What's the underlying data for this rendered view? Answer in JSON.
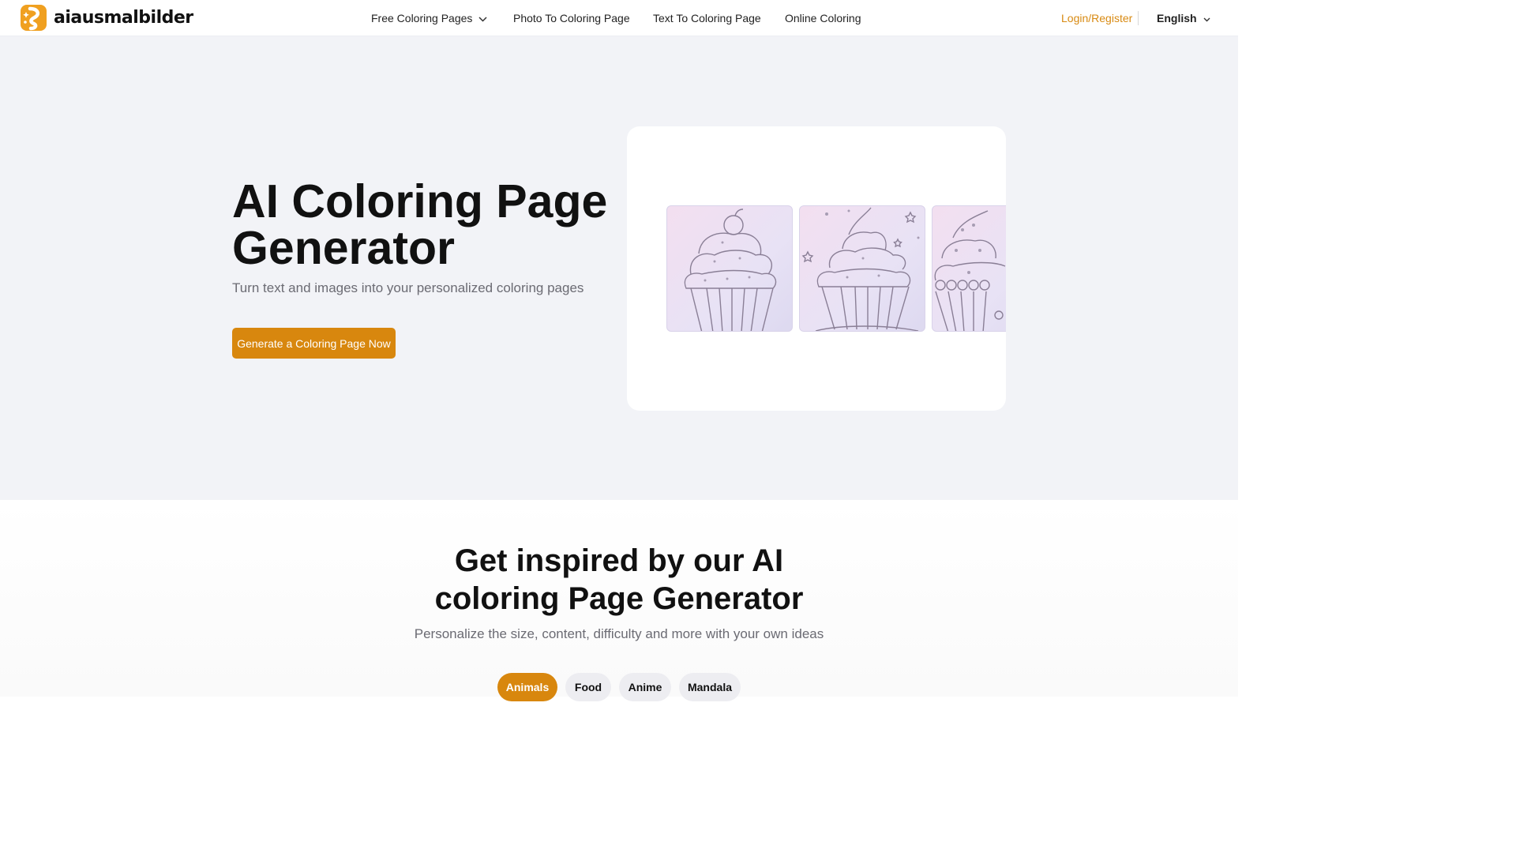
{
  "brand": {
    "name": "aiausmalbilder",
    "accent": "#f0a020"
  },
  "nav": {
    "items": [
      {
        "label": "Free Coloring Pages",
        "has_dropdown": true
      },
      {
        "label": "Photo To Coloring Page"
      },
      {
        "label": "Text To Coloring Page"
      },
      {
        "label": "Online Coloring"
      }
    ],
    "login_label": "Login/Register",
    "language": "English"
  },
  "hero": {
    "title": "AI Coloring Page Generator",
    "subtitle": "Turn text and images into your personalized coloring pages",
    "cta_label": "Generate a Coloring Page Now",
    "cta_color": "#d8870e",
    "showcase_images": [
      "cupcake-with-cherry",
      "cupcake-with-stars",
      "cupcake-with-dots"
    ]
  },
  "inspire": {
    "title": "Get inspired by our AI coloring Page Generator",
    "subtitle": "Personalize the size, content, difficulty and more with your own ideas",
    "categories": [
      {
        "label": "Animals",
        "active": true
      },
      {
        "label": "Food"
      },
      {
        "label": "Anime"
      },
      {
        "label": "Mandala"
      }
    ]
  }
}
